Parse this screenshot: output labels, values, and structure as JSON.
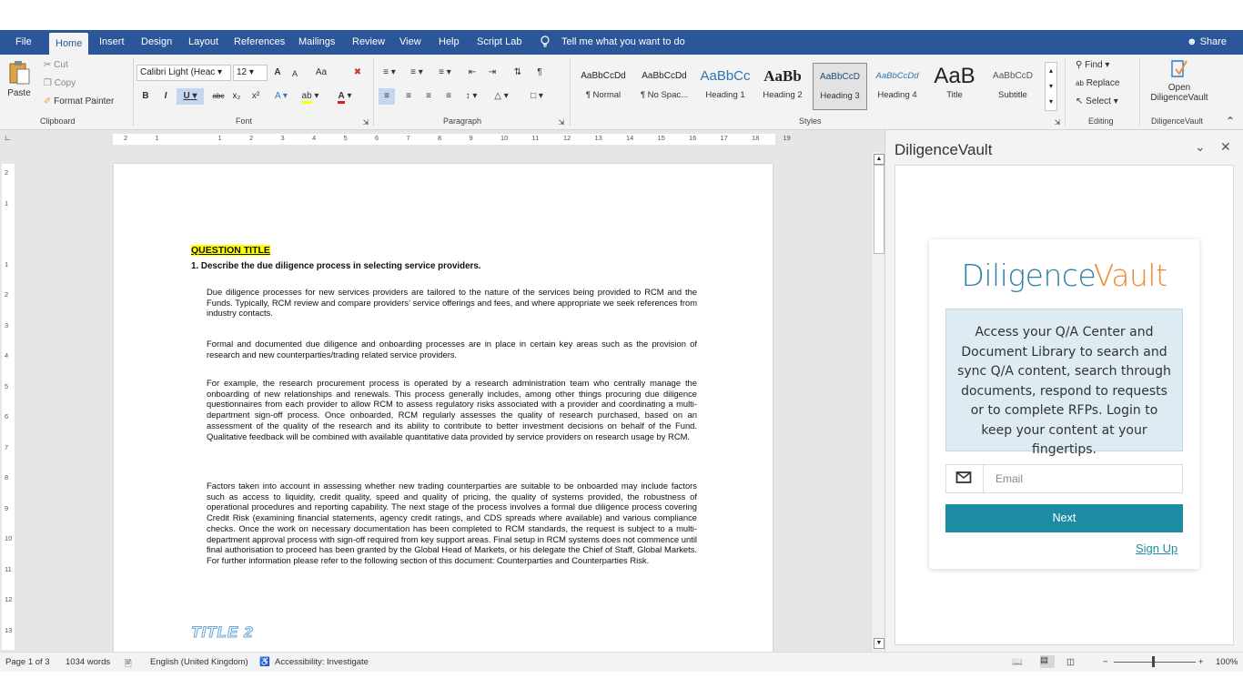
{
  "ribbon_tabs": [
    "File",
    "Home",
    "Insert",
    "Design",
    "Layout",
    "References",
    "Mailings",
    "Review",
    "View",
    "Help",
    "Script Lab"
  ],
  "tell_me": "Tell me what you want to do",
  "share": "Share",
  "clipboard": {
    "paste": "Paste",
    "cut": "Cut",
    "copy": "Copy",
    "format_painter": "Format Painter",
    "label": "Clipboard"
  },
  "font": {
    "name": "Calibri Light (Heac",
    "size": "12",
    "label": "Font",
    "grow": "A",
    "shrink": "A",
    "case": "Aa"
  },
  "paragraph": {
    "label": "Paragraph"
  },
  "styles": {
    "label": "Styles",
    "items": [
      {
        "preview": "AaBbCcDd",
        "name": "¶ Normal"
      },
      {
        "preview": "AaBbCcDd",
        "name": "¶ No Spac..."
      },
      {
        "preview": "AaBbCc",
        "name": "Heading 1"
      },
      {
        "preview": "AaBb",
        "name": "Heading 2"
      },
      {
        "preview": "AaBbCcD",
        "name": "Heading 3"
      },
      {
        "preview": "AaBbCcDd",
        "name": "Heading 4"
      },
      {
        "preview": "AaB",
        "name": "Title"
      },
      {
        "preview": "AaBbCcD",
        "name": "Subtitle"
      }
    ]
  },
  "editing": {
    "find": "Find",
    "replace": "Replace",
    "select": "Select",
    "label": "Editing"
  },
  "addin": {
    "open_line1": "Open",
    "open_line2": "DiligenceVault",
    "label": "DiligenceVault"
  },
  "ruler_numbers": [
    "2",
    "1",
    "1",
    "2",
    "3",
    "4",
    "5",
    "6",
    "7",
    "8",
    "9",
    "10",
    "11",
    "12",
    "13",
    "14",
    "15",
    "16",
    "17",
    "18",
    "19"
  ],
  "vruler_numbers": [
    "2",
    "1",
    "1",
    "2",
    "3",
    "4",
    "5",
    "6",
    "7",
    "8",
    "9",
    "10",
    "11",
    "12",
    "13"
  ],
  "document": {
    "question_title": "QUESTION TITLE",
    "question": "1.  Describe the due diligence process in selecting service providers.",
    "paragraphs": [
      "Due diligence processes for new services providers are tailored to the nature of the services being provided to RCM and the Funds. Typically, RCM review and compare providers’ service offerings and fees, and where appropriate we seek references from industry contacts.",
      "Formal and documented due diligence and onboarding processes are in place in certain key areas such as the provision of research and new counterparties/trading related service providers.",
      "For example, the research procurement process is operated by a research administration team who centrally manage the onboarding of new relationships and renewals. This process generally includes, among other things procuring due diligence questionnaires from each provider to allow RCM to assess regulatory risks associated with a provider and coordinating a multi-department sign-off process. Once onboarded, RCM regularly assesses the quality of research purchased, based on an assessment of the quality of the research and its ability to contribute to better investment decisions on behalf of the Fund.  Qualitative feedback will be combined with available quantitative data provided by service providers on research usage by RCM.",
      "Factors taken into account in assessing whether new trading counterparties are suitable to be onboarded may include factors such as access to liquidity, credit quality, speed and quality of pricing, the quality of systems provided, the robustness of operational procedures and reporting capability. The next stage of the process involves a formal due diligence process covering Credit Risk (examining financial statements, agency credit ratings, and CDS spreads where available) and various compliance checks. Once the work on necessary documentation has been completed to RCM standards, the request is subject to a multi-department approval process with sign-off required from key support areas. Final setup in RCM systems does not commence until final authorisation to proceed has been granted by the Global Head of Markets, or his delegate the Chief of Staff, Global Markets. For further information please refer to the following section of this document: Counterparties and Counterparties Risk."
    ],
    "title2": "TITLE 2"
  },
  "pane": {
    "title": "DiligenceVault",
    "logo_part1": "Diligence",
    "logo_part2": "Vault",
    "info": "Access your Q/A Center and Document Library to search and sync Q/A content, search through documents, respond to requests or to complete RFPs. Login to keep your content at your fingertips.",
    "email_placeholder": "Email",
    "next": "Next",
    "signup": "Sign Up"
  },
  "status": {
    "page": "Page 1 of 3",
    "words": "1034 words",
    "language": "English (United Kingdom)",
    "accessibility": "Accessibility: Investigate",
    "zoom": "100%"
  },
  "colors": {
    "ribbon_blue": "#2b579a",
    "teal": "#1e8ba5",
    "logo_blue": "#2d7ea8",
    "logo_orange": "#ef8a2f",
    "highlight": "#ffff00"
  }
}
